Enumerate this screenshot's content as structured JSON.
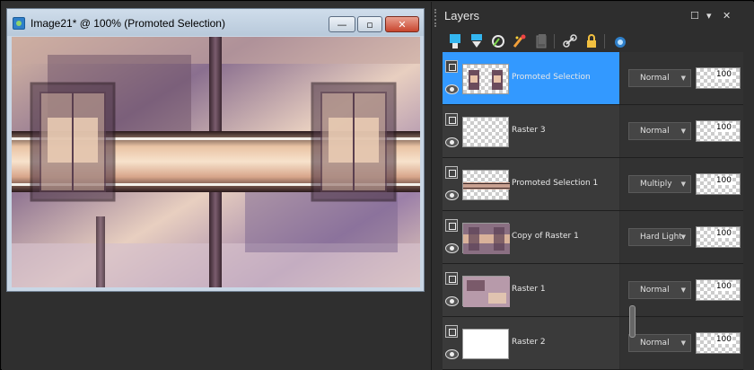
{
  "image_window": {
    "title": "Image21* @ 100% (Promoted Selection)",
    "minimize": "—",
    "maximize": "▫",
    "close": "✕"
  },
  "layers_panel": {
    "title": "Layers",
    "controls": {
      "restore": "☐",
      "menu": "▾",
      "close": "✕"
    },
    "toolbar_icons": [
      "new-raster-layer-icon",
      "new-vector-layer-icon",
      "new-mask-layer-icon",
      "adjustment-layer-icon",
      "duplicate-layer-icon",
      "link-icon",
      "lock-icon",
      "visibility-icon"
    ],
    "layers": [
      {
        "name": "Promoted Selection",
        "blend": "Normal",
        "opacity": "100",
        "selected": true
      },
      {
        "name": "Raster 3",
        "blend": "Normal",
        "opacity": "100",
        "selected": false
      },
      {
        "name": "Promoted Selection 1",
        "blend": "Multiply",
        "opacity": "100",
        "selected": false
      },
      {
        "name": "Copy of Raster 1",
        "blend": "Hard Light",
        "opacity": "100",
        "selected": false
      },
      {
        "name": "Raster 1",
        "blend": "Normal",
        "opacity": "100",
        "selected": false
      },
      {
        "name": "Raster 2",
        "blend": "Normal",
        "opacity": "100",
        "selected": false
      }
    ]
  },
  "colors": {
    "selected_row": "#3399ff",
    "panel_bg": "#2e2e2e",
    "titlebar": "#cfddeb"
  }
}
